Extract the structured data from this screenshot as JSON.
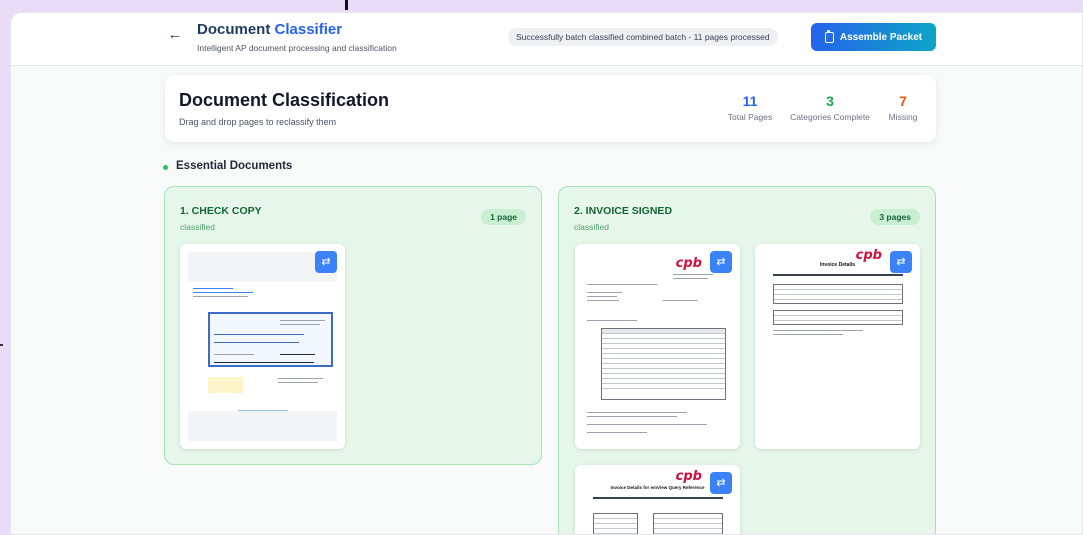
{
  "header": {
    "title_main": "Document ",
    "title_accent": "Classifier",
    "subtitle": "Intelligent AP document processing and classification",
    "status_message": "Successfully batch classified combined batch - 11 pages processed",
    "assemble_label": "Assemble Packet"
  },
  "summary": {
    "title": "Document Classification",
    "subtitle": "Drag and drop pages to reclassify them",
    "stats": [
      {
        "value": "11",
        "label": "Total Pages",
        "color": "#2563eb"
      },
      {
        "value": "3",
        "label": "Categories Complete",
        "color": "#16a34a"
      },
      {
        "value": "7",
        "label": "Missing",
        "color": "#ea580c"
      }
    ]
  },
  "section": {
    "title": "Essential Documents"
  },
  "categories": [
    {
      "title": "1. CHECK COPY",
      "status": "classified",
      "page_count": "1 page"
    },
    {
      "title": "2. INVOICE SIGNED",
      "status": "classified",
      "page_count": "3 pages"
    }
  ],
  "thumbnails": {
    "invoice_p1": {
      "logo": "cpb"
    },
    "invoice_p2": {
      "logo": "cpb",
      "heading": "Invoice Details"
    },
    "invoice_p3": {
      "logo": "cpb",
      "heading": "Invoice Details for emView Query Reference"
    }
  },
  "icons": {
    "back": "arrow-left-icon",
    "clipboard": "clipboard-icon",
    "reclassify": "swap-arrows-icon"
  }
}
